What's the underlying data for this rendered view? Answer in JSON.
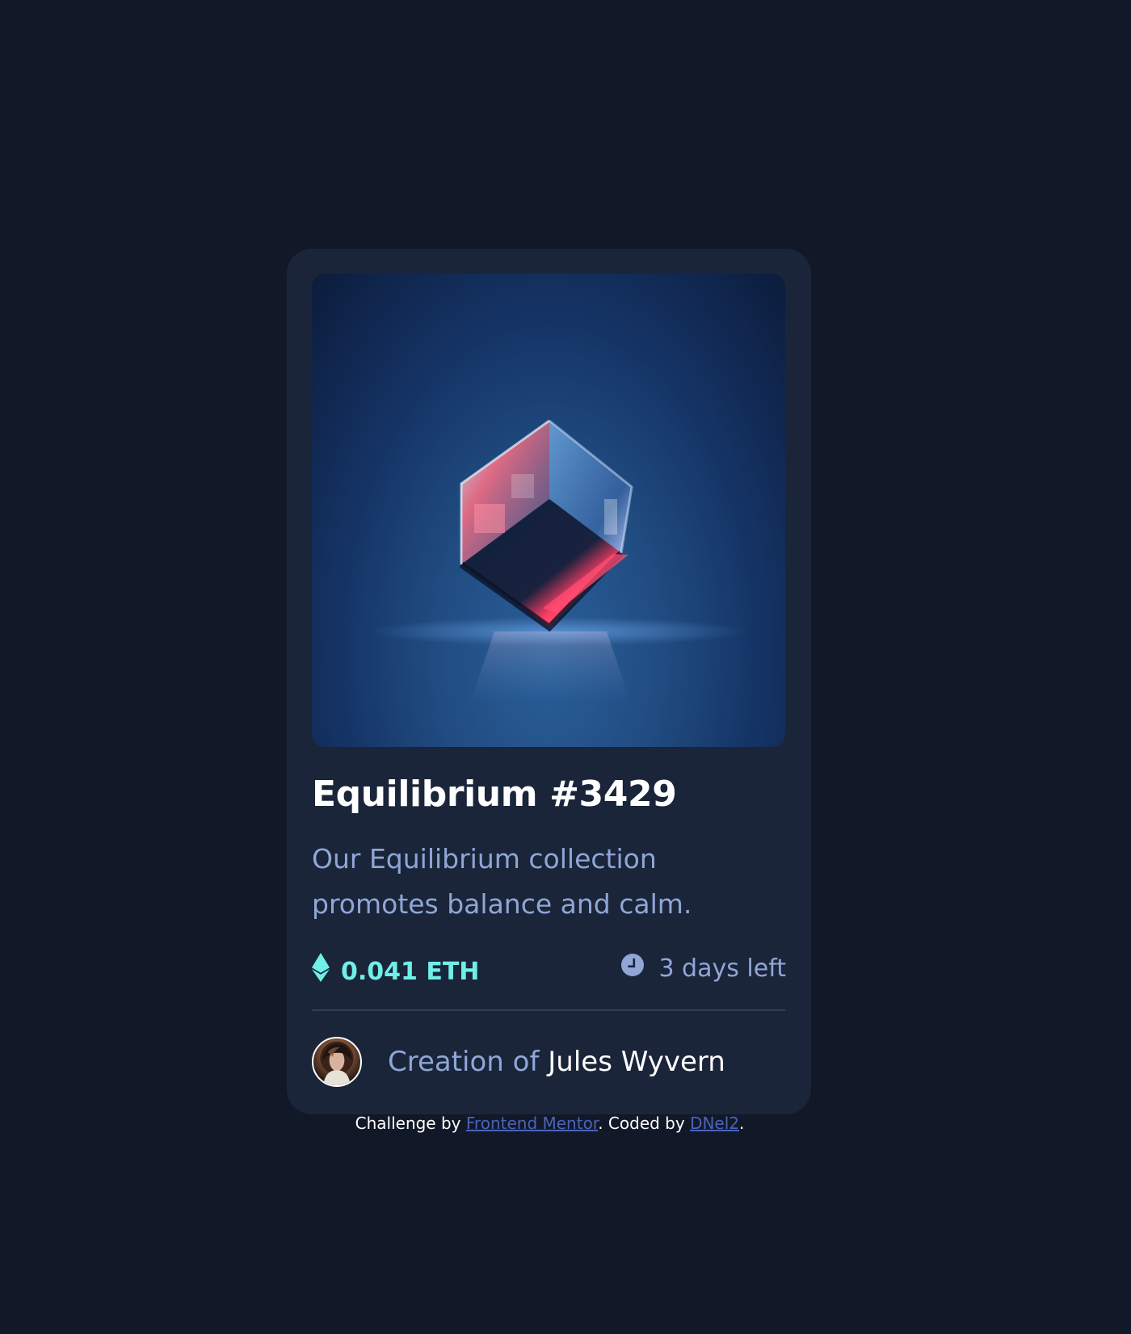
{
  "card": {
    "image": {
      "alt": "Equilibrium #3429"
    },
    "title": "Equilibrium #3429",
    "description": "Our Equilibrium collection promotes balance and calm.",
    "price": {
      "value": "0.041 ETH",
      "icon": "ethereum-icon"
    },
    "time": {
      "value": "3 days left",
      "icon": "clock-icon"
    },
    "creator": {
      "prefix": "Creation of ",
      "name": "Jules Wyvern",
      "avatar_icon": "avatar"
    }
  },
  "footer": {
    "challenge_prefix": "Challenge by ",
    "challenge_link": "Frontend Mentor",
    "middle": ". Coded by ",
    "coder_link": "DNel2",
    "suffix": "."
  },
  "colors": {
    "page_background": "#111828",
    "card_background": "#1a253a",
    "accent": "#70efe8",
    "muted_text": "#8fa6d6",
    "link": "#4d63b8"
  }
}
